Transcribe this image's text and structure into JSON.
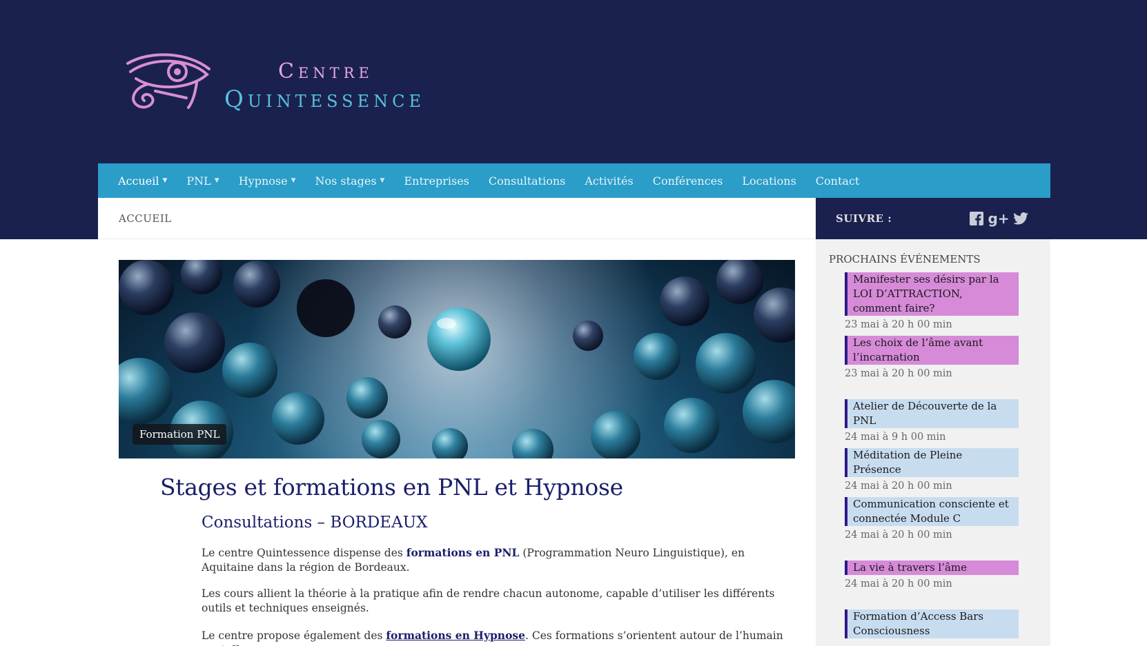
{
  "logo": {
    "line1": "Centre",
    "line2": "Quintessence"
  },
  "nav": {
    "items": [
      {
        "label": "Accueil",
        "caret": true
      },
      {
        "label": "PNL",
        "caret": true
      },
      {
        "label": "Hypnose",
        "caret": true
      },
      {
        "label": "Nos stages",
        "caret": true
      },
      {
        "label": "Entreprises",
        "caret": false
      },
      {
        "label": "Consultations",
        "caret": false
      },
      {
        "label": "Activités",
        "caret": false
      },
      {
        "label": "Conférences",
        "caret": false
      },
      {
        "label": "Locations",
        "caret": false
      },
      {
        "label": "Contact",
        "caret": false
      }
    ]
  },
  "breadcrumb": "ACCUEIL",
  "hero": {
    "badge": "Formation PNL"
  },
  "content": {
    "title": "Stages et formations en PNL et Hypnose",
    "subtitle": "Consultations – BORDEAUX",
    "p1_before": "Le centre Quintessence dispense des ",
    "p1_strong": "formations en PNL",
    "p1_after": " (Programmation Neuro Linguistique), en Aquitaine dans la région de Bordeaux.",
    "p2": "Les cours allient la théorie à la pratique afin de rendre chacun autonome, capable d’utiliser les différents outils et techniques enseignés.",
    "p3_before": "Le centre propose également des ",
    "p3_link": "formations en Hypnose",
    "p3_after": ". Ces formations s’orientent autour de l’humain et s’effectuent"
  },
  "follow": {
    "label": "SUIVRE :",
    "icons": [
      "facebook-icon",
      "google-plus-icon",
      "twitter-icon"
    ]
  },
  "sidebar": {
    "title": "PROCHAINS ÉVÉNEMENTS",
    "events": [
      {
        "name": "Manifester ses désirs par la LOI D’ATTRACTION, comment faire?",
        "date": "23 mai à 20 h 00 min",
        "color": "pink"
      },
      {
        "name": "Les choix de l’âme avant l’incarnation",
        "date": "23 mai à 20 h 00 min",
        "color": "pink"
      },
      {
        "name": "Atelier de Découverte de la PNL",
        "date": "24 mai à 9 h 00 min",
        "color": "blue"
      },
      {
        "name": "Méditation de Pleine Présence",
        "date": "24 mai à 20 h 00 min",
        "color": "blue"
      },
      {
        "name": "Communication consciente et connectée Module C",
        "date": "24 mai à 20 h 00 min",
        "color": "blue"
      },
      {
        "name": "La vie à travers l’âme",
        "date": "24 mai à 20 h 00 min",
        "color": "pink"
      },
      {
        "name": "Formation d’Access Bars Consciousness",
        "date": "",
        "color": "blue"
      }
    ]
  },
  "colors": {
    "header_bg": "#1a214e",
    "nav_bg": "#2a9dc8",
    "heading": "#1a1f6a",
    "event_pink": "#d68ad8",
    "event_blue": "#c8dcf0"
  }
}
